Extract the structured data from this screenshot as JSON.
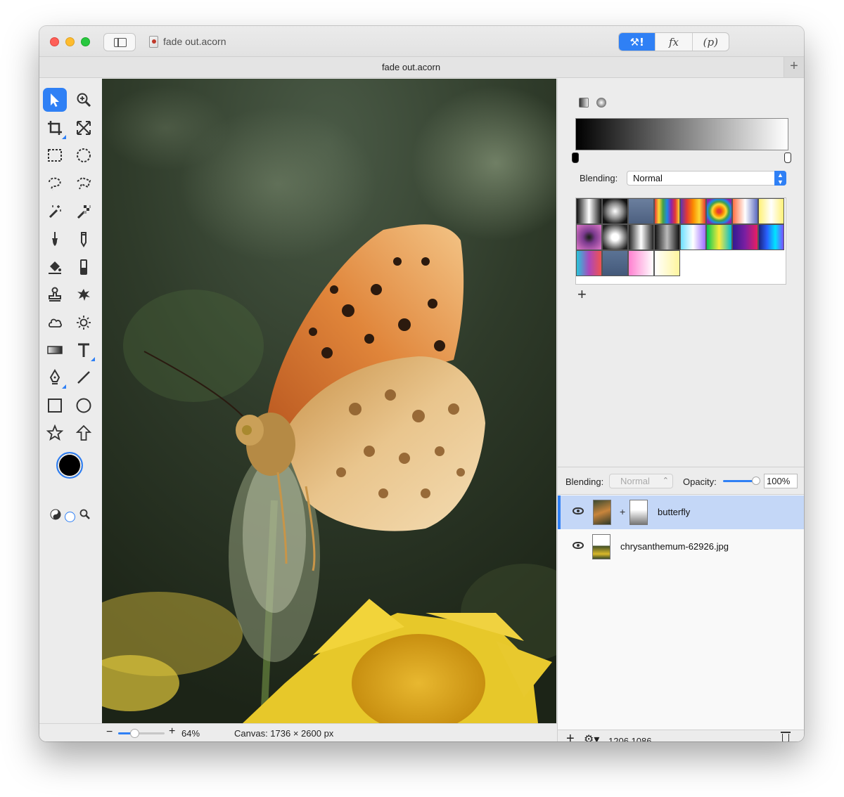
{
  "window": {
    "title": "fade out.acorn",
    "tab_title": "fade out.acorn",
    "segments": [
      {
        "label": "⚒!",
        "name": "tools"
      },
      {
        "label": "fx",
        "name": "effects"
      },
      {
        "label": "(p)",
        "name": "plugins"
      }
    ],
    "tab_add": "+"
  },
  "toolbox": {
    "selected": "select-tool",
    "tools": [
      "select",
      "zoom",
      "crop",
      "transform",
      "rect-select",
      "ellipse-select",
      "lasso",
      "polygon-lasso",
      "magic-wand",
      "instant-alpha",
      "brush",
      "pencil",
      "paint-bucket",
      "eraser",
      "clone-stamp",
      "smudge",
      "cloud",
      "sun",
      "gradient",
      "text",
      "pen",
      "line",
      "rectangle",
      "circle",
      "star",
      "arrow"
    ],
    "foreground_color": "#000000",
    "background_color": "#ffffff"
  },
  "status": {
    "zoom_minus": "−",
    "zoom_plus": "+",
    "zoom_percent": "64%",
    "zoom_fraction": 0.35,
    "canvas_size": "Canvas: 1736 × 2600 px"
  },
  "gradient_panel": {
    "blending_label": "Blending:",
    "blending_value": "Normal",
    "add_label": "+",
    "start_color": "#000000",
    "end_color": "#ffffff",
    "presets": [
      "linear-gradient(90deg,#111,#fff,#111)",
      "radial-gradient(circle,#fff 0%,#888 45%,#111 80%)",
      "linear-gradient(#6b7f9e,#4d6080)",
      "linear-gradient(90deg,#e53935,#fdd835,#43a047,#1e88e5,#8e24aa,#e53935,#fdd835)",
      "linear-gradient(90deg,#5e35b1,#e53935,#fb8c00,#fdd835,#e53935)",
      "radial-gradient(circle,#e53935 10%,#fb8c00 25%,#fdd835 40%,#43a047 55%,#1e88e5 70%,#8e24aa 85%)",
      "linear-gradient(90deg,#ff7043,#fff,#5c6bc0),repeating-conic-gradient(#ccc 0 25%,#fff 0 50%) 0 0/8px 8px",
      "linear-gradient(90deg,#fff176,#fff,#fff176),repeating-conic-gradient(#ccc 0 25%,#fff 0 50%) 0 0/8px 8px",
      "radial-gradient(circle,#222 5%,#7b3a8e 35%,#d070c0 90%)",
      "radial-gradient(circle,#fff 20%,#999 50%,#222 85%)",
      "linear-gradient(90deg,#222,#fff,#222),repeating-conic-gradient(#bbb 0 25%,#fff 0 50%) 0 0/8px 8px",
      "linear-gradient(90deg,#111,#bbb,#111)",
      "linear-gradient(90deg,#6ce0ff,#fff,#9b6cff)",
      "linear-gradient(90deg,#00c853,#ffeb3b,#00bcd4)",
      "linear-gradient(90deg,#311b92,#7b1fa2,#e91e63)",
      "linear-gradient(90deg,#1a237e,#2962ff,#00e5ff,#7c4dff)",
      "linear-gradient(90deg,#26c6da,#ab47bc,#ef5350)",
      "linear-gradient(#5b7395,#44597a)",
      "linear-gradient(90deg,#ff80d0,#fff)",
      "linear-gradient(90deg,#fff,#fff59d)"
    ]
  },
  "layers_panel": {
    "blending_label": "Blending:",
    "blending_value": "Normal",
    "opacity_label": "Opacity:",
    "opacity_value": "100%",
    "layers": [
      {
        "name": "butterfly",
        "selected": true
      },
      {
        "name": "chrysanthemum-62926.jpg",
        "selected": false
      }
    ],
    "add_label": "+",
    "gear_label": "⚙▾",
    "coordinates": "1206,1086"
  },
  "colors": {
    "accent": "#2f80f5",
    "selection_row": "#c4d7f7"
  }
}
